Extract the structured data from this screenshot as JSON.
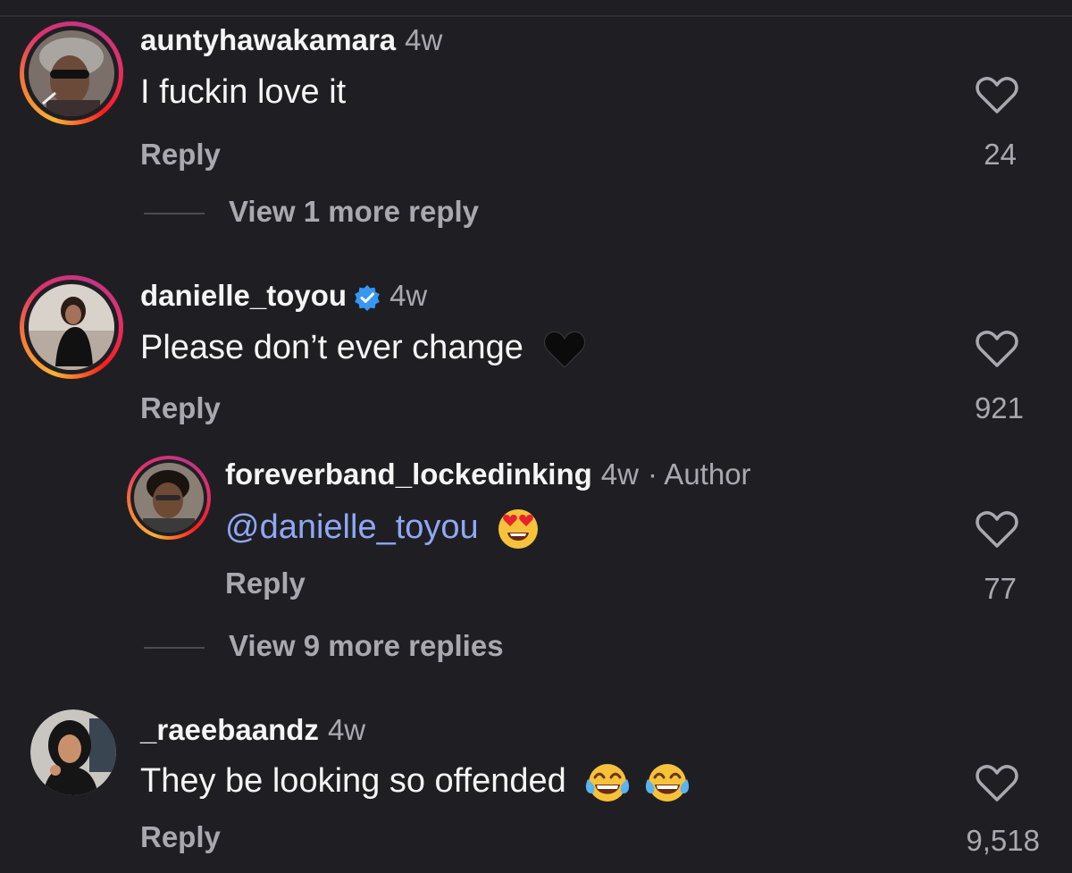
{
  "comments": [
    {
      "username": "auntyhawakamara",
      "time": "4w",
      "text": "I fuckin love it",
      "reply_label": "Reply",
      "likes": "24",
      "view_more": "View 1 more reply"
    },
    {
      "username": "danielle_toyou",
      "time": "4w",
      "verified": true,
      "text": "Please don’t ever change",
      "reply_label": "Reply",
      "likes": "921"
    },
    {
      "username": "foreverband_lockedinking",
      "time": "4w",
      "author_tag": "· Author",
      "mention": "@danielle_toyou",
      "reply_label": "Reply",
      "likes": "77",
      "view_more": "View 9 more replies"
    },
    {
      "username": "_raeebaandz",
      "time": "4w",
      "text": "They be looking so offended",
      "reply_label": "Reply",
      "likes": "9,518"
    }
  ],
  "colors": {
    "background": "#1f1f23",
    "text": "#f5f5f5",
    "muted": "#a8a8ae",
    "mention": "#8ea8f5",
    "verified": "#3897f0"
  },
  "icons": [
    "heart-outline-icon",
    "verified-badge-icon",
    "black-heart-emoji",
    "heart-eyes-emoji",
    "tears-of-joy-emoji"
  ]
}
